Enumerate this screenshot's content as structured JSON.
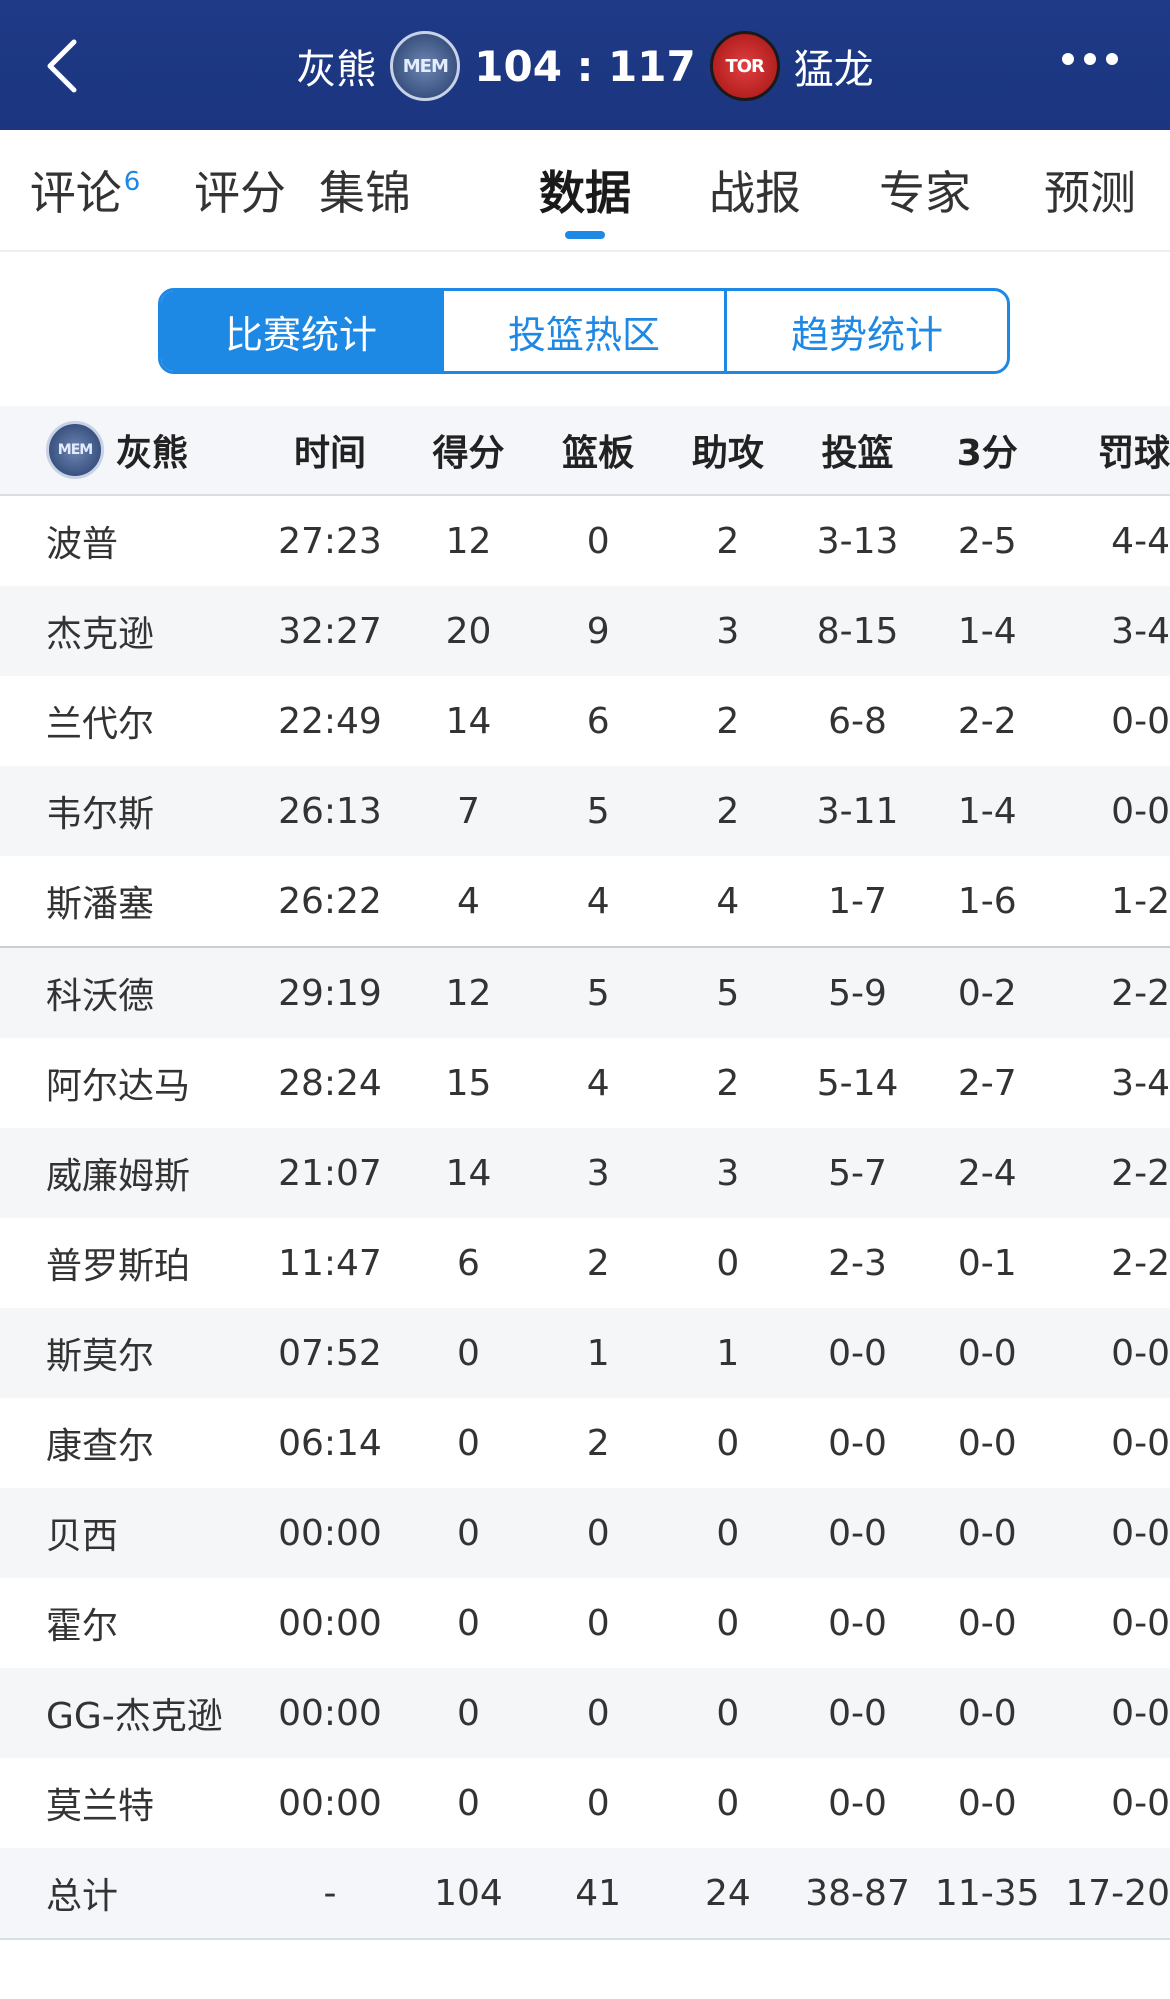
{
  "header": {
    "home_team": "灰熊",
    "home_logo": "MEM",
    "score": "104 : 117",
    "away_logo": "TOR",
    "away_team": "猛龙"
  },
  "tabs": [
    {
      "label": "评论",
      "badge": "6"
    },
    {
      "label": "评分"
    },
    {
      "label": "集锦"
    },
    {
      "label": "数据"
    },
    {
      "label": "战报"
    },
    {
      "label": "专家"
    },
    {
      "label": "预测"
    }
  ],
  "active_tab": "数据",
  "segments": [
    "比赛统计",
    "投篮热区",
    "趋势统计"
  ],
  "active_segment": "比赛统计",
  "table": {
    "team_label": "灰熊",
    "team_logo": "MEM",
    "headers": [
      "时间",
      "得分",
      "篮板",
      "助攻",
      "投篮",
      "3分",
      "罚球"
    ],
    "rows": [
      [
        "波普",
        "27:23",
        "12",
        "0",
        "2",
        "3-13",
        "2-5",
        "4-4"
      ],
      [
        "杰克逊",
        "32:27",
        "20",
        "9",
        "3",
        "8-15",
        "1-4",
        "3-4"
      ],
      [
        "兰代尔",
        "22:49",
        "14",
        "6",
        "2",
        "6-8",
        "2-2",
        "0-0"
      ],
      [
        "韦尔斯",
        "26:13",
        "7",
        "5",
        "2",
        "3-11",
        "1-4",
        "0-0"
      ],
      [
        "斯潘塞",
        "26:22",
        "4",
        "4",
        "4",
        "1-7",
        "1-6",
        "1-2"
      ],
      [
        "科沃德",
        "29:19",
        "12",
        "5",
        "5",
        "5-9",
        "0-2",
        "2-2"
      ],
      [
        "阿尔达马",
        "28:24",
        "15",
        "4",
        "2",
        "5-14",
        "2-7",
        "3-4"
      ],
      [
        "威廉姆斯",
        "21:07",
        "14",
        "3",
        "3",
        "5-7",
        "2-4",
        "2-2"
      ],
      [
        "普罗斯珀",
        "11:47",
        "6",
        "2",
        "0",
        "2-3",
        "0-1",
        "2-2"
      ],
      [
        "斯莫尔",
        "07:52",
        "0",
        "1",
        "1",
        "0-0",
        "0-0",
        "0-0"
      ],
      [
        "康查尔",
        "06:14",
        "0",
        "2",
        "0",
        "0-0",
        "0-0",
        "0-0"
      ],
      [
        "贝西",
        "00:00",
        "0",
        "0",
        "0",
        "0-0",
        "0-0",
        "0-0"
      ],
      [
        "霍尔",
        "00:00",
        "0",
        "0",
        "0",
        "0-0",
        "0-0",
        "0-0"
      ],
      [
        "GG-杰克逊",
        "00:00",
        "0",
        "0",
        "0",
        "0-0",
        "0-0",
        "0-0"
      ],
      [
        "莫兰特",
        "00:00",
        "0",
        "0",
        "0",
        "0-0",
        "0-0",
        "0-0"
      ]
    ],
    "total": [
      "总计",
      "-",
      "104",
      "41",
      "24",
      "38-87",
      "11-35",
      "17-20"
    ]
  },
  "colors": {
    "header_bg": "#1f3a86",
    "accent": "#1e88e5"
  }
}
